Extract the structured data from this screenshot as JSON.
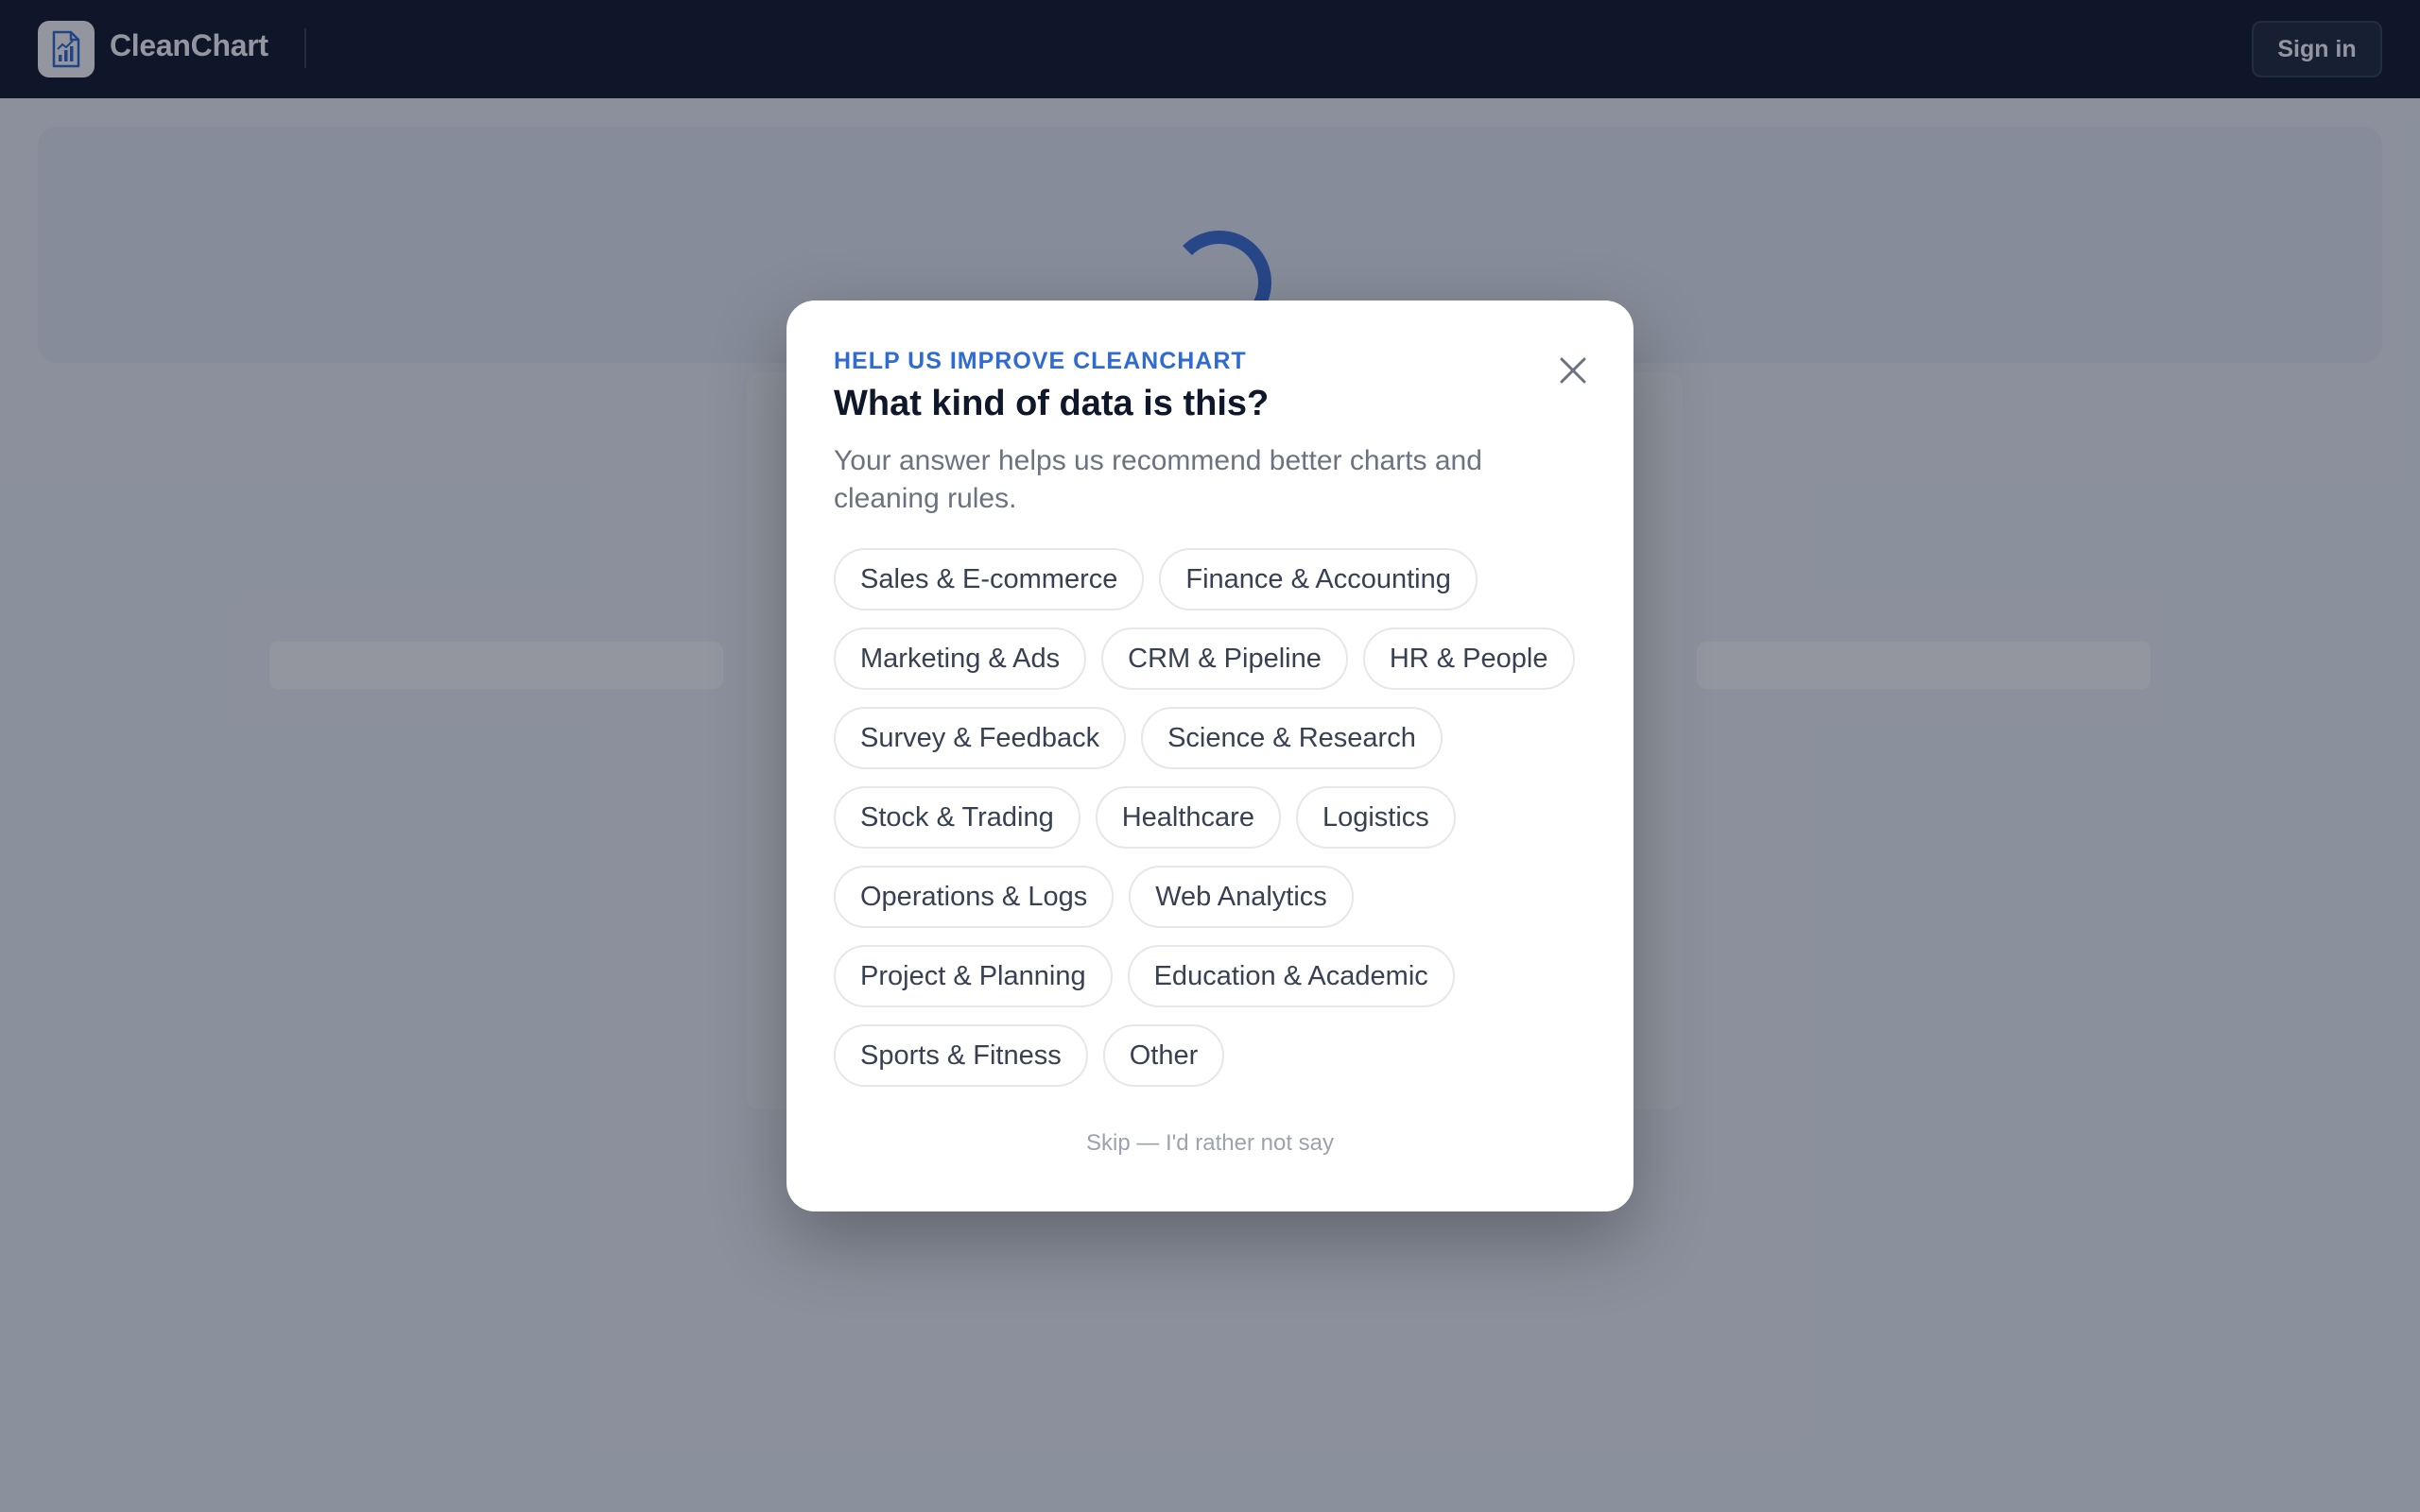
{
  "app": {
    "brand": "CleanChart",
    "logo_icon": "chart-document-icon",
    "sign_in_label": "Sign in"
  },
  "modal": {
    "eyebrow": "HELP US IMPROVE CLEANCHART",
    "title": "What kind of data is this?",
    "subtitle": "Your answer helps us recommend better charts and cleaning rules.",
    "close_icon": "close-icon",
    "options": [
      [
        "Sales & E-commerce",
        "Finance & Accounting"
      ],
      [
        "Marketing & Ads",
        "CRM & Pipeline",
        "HR & People"
      ],
      [
        "Survey & Feedback",
        "Science & Research"
      ],
      [
        "Stock & Trading",
        "Healthcare",
        "Logistics"
      ],
      [
        "Operations & Logs",
        "Web Analytics"
      ],
      [
        "Project & Planning",
        "Education & Academic"
      ],
      [
        "Sports & Fitness",
        "Other"
      ]
    ],
    "skip_label": "Skip — I'd rather not say"
  },
  "colors": {
    "nav_bg": "#0f172a",
    "accent": "#2f6bd1",
    "chip_border": "#e5e7eb"
  }
}
